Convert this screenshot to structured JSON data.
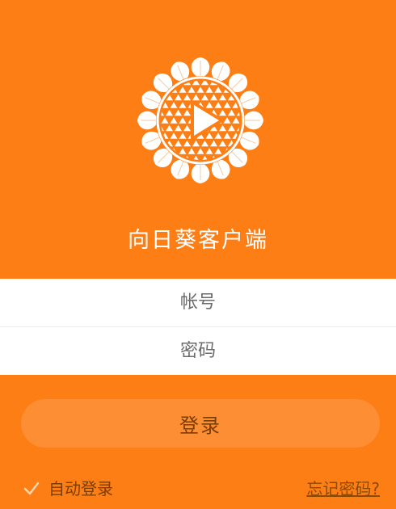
{
  "app": {
    "title": "向日葵客户端"
  },
  "login_form": {
    "account_placeholder": "帐号",
    "password_placeholder": "密码"
  },
  "login_button": {
    "label": "登录"
  },
  "auto_login": {
    "label": "自动登录",
    "checked": true
  },
  "forgot_password": {
    "label": "忘记密码?"
  },
  "icons": {
    "logo": "sunflower-logo-icon",
    "check": "checkmark-icon"
  },
  "colors": {
    "background": "#fd7e14",
    "button": "#fe8e33",
    "text_dark": "#7a3d00"
  }
}
